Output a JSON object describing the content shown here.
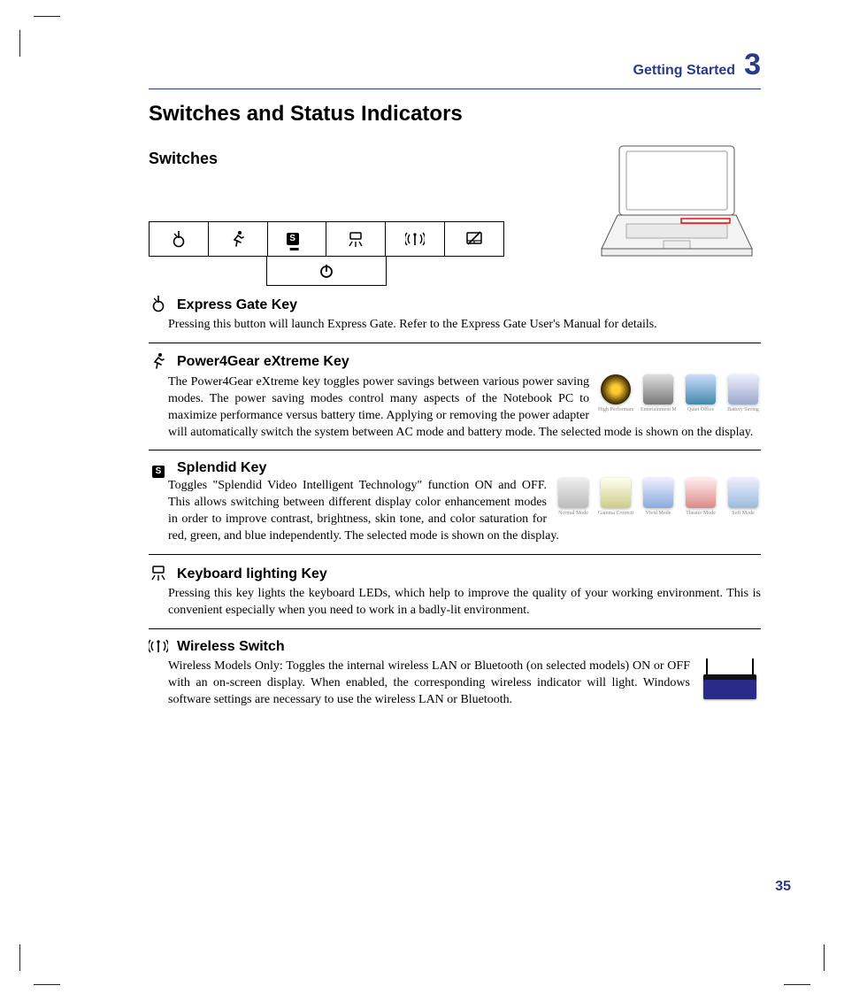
{
  "chapter": {
    "title": "Getting Started",
    "number": "3"
  },
  "page_title": "Switches and Status Indicators",
  "switches_heading": "Switches",
  "sections": {
    "express_gate": {
      "title": "Express Gate Key",
      "body": "Pressing this button will launch Express Gate. Refer to the Express Gate User's Manual for details."
    },
    "power4gear": {
      "title": "Power4Gear eXtreme Key",
      "body1": "The Power4Gear eXtreme key toggles power savings between various power saving modes. The power saving modes control many aspects of the Notebook PC to maximize performance versus",
      "body2": "battery time. Applying or removing the power adapter will automatically switch the system between AC mode and battery mode. The selected mode is shown on the display.",
      "modes": [
        "High Performance",
        "Entertainment Mode",
        "Quiet Office",
        "Battery Saving"
      ]
    },
    "splendid": {
      "title": "Splendid Key",
      "body1": "Toggles \"Splendid Video Intelligent Technology\" function ON and OFF. This allows switching between different display color enhancement modes in order to improve contrast, brightness, skin tone, and",
      "body2": "color saturation for red, green, and blue independently. The selected mode is shown on the display.",
      "modes": [
        "Normal Mode",
        "Gamma Correction",
        "Vivid Mode",
        "Theater Mode",
        "Soft Mode"
      ]
    },
    "keyboard_lighting": {
      "title": "Keyboard lighting Key",
      "body": "Pressing this key lights the keyboard LEDs, which help to improve the quality of your working environment. This is convenient especially when you need to work in a badly-lit environment."
    },
    "wireless": {
      "title": "Wireless Switch",
      "body": "Wireless Models Only: Toggles the internal wireless LAN or Bluetooth (on selected models) ON or OFF with an on-screen display. When enabled, the corresponding wireless indicator will light. Windows software settings are necessary to use the wireless LAN or Bluetooth."
    }
  },
  "icons": {
    "express_gate": "express-gate-icon",
    "runner": "runner-icon",
    "splendid": "S",
    "keyboard_light": "keyboard-light-icon",
    "wifi": "wifi-icon",
    "touchpad": "touchpad-lock-icon",
    "power": "power-icon"
  },
  "page_number": "35"
}
